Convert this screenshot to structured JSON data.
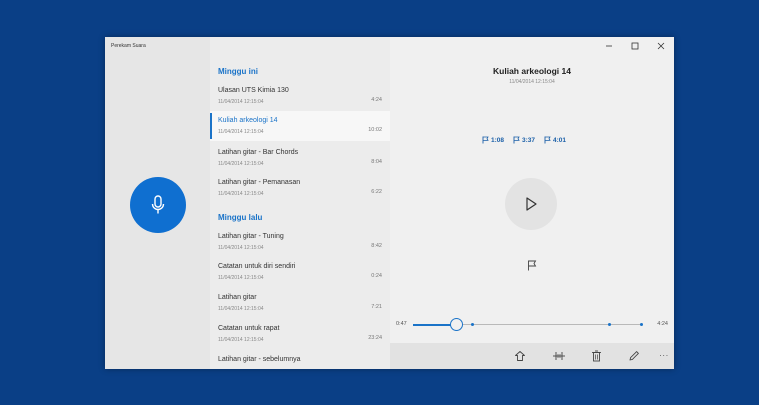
{
  "app": {
    "title": "Perekam Suara"
  },
  "colors": {
    "accent": "#1a73c8",
    "record_button": "#0f6fd0",
    "desktop_background": "#0a3f86"
  },
  "sections": [
    {
      "header": "Minggu ini",
      "items": [
        {
          "title": "Ulasan UTS Kimia 130",
          "date": "11/04/2014 12:15:04",
          "duration": "4:24",
          "selected": false
        },
        {
          "title": "Kuliah arkeologi 14",
          "date": "11/04/2014 12:15:04",
          "duration": "10:02",
          "selected": true
        },
        {
          "title": "Latihan gitar - Bar Chords",
          "date": "11/04/2014 12:15:04",
          "duration": "8:04",
          "selected": false
        },
        {
          "title": "Latihan gitar - Pemanasan",
          "date": "11/04/2014 12:15:04",
          "duration": "6:22",
          "selected": false
        }
      ]
    },
    {
      "header": "Minggu lalu",
      "items": [
        {
          "title": "Latihan gitar - Tuning",
          "date": "11/04/2014 12:15:04",
          "duration": "8:42",
          "selected": false
        },
        {
          "title": "Catatan untuk diri sendiri",
          "date": "11/04/2014 12:15:04",
          "duration": "0:24",
          "selected": false
        },
        {
          "title": "Latihan gitar",
          "date": "11/04/2014 12:15:04",
          "duration": "7:21",
          "selected": false
        },
        {
          "title": "Catatan untuk rapat",
          "date": "11/04/2014 12:15:04",
          "duration": "23:24",
          "selected": false
        },
        {
          "title": "Latihan gitar - sebelumnya",
          "date": "",
          "duration": "",
          "selected": false
        }
      ]
    }
  ],
  "player": {
    "title": "Kuliah arkeologi 14",
    "date": "11/04/2014 12:15:04",
    "markers": [
      "1:08",
      "3:37",
      "4:01"
    ],
    "current_time": "0:47",
    "total_time": "4:24",
    "progress": 0.19,
    "marker_positions": [
      0.26,
      0.86,
      1.0
    ]
  },
  "icons": {
    "record": "microphone-icon",
    "play": "play-icon",
    "marker": "flag-icon",
    "toolbar": [
      "share-icon",
      "trim-icon",
      "delete-icon",
      "rename-icon",
      "more-icon"
    ]
  }
}
